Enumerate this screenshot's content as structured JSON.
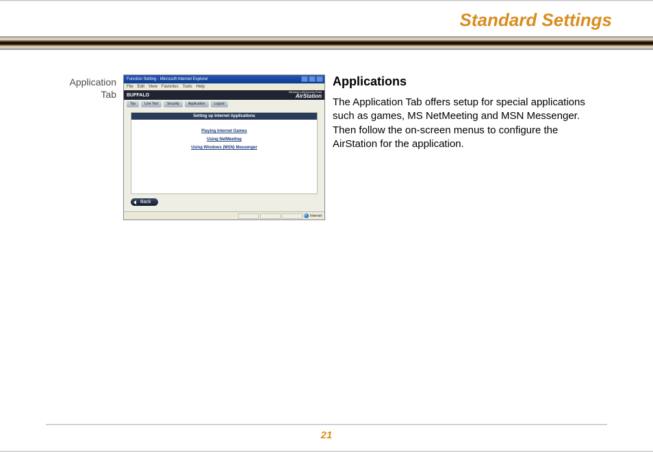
{
  "header": {
    "section_title": "Standard Settings"
  },
  "caption": {
    "line1": "Application",
    "line2": "Tab"
  },
  "screenshot": {
    "window_title": "Function Setting - Microsoft Internet Explorer",
    "menu": {
      "file": "File",
      "edit": "Edit",
      "view": "View",
      "favorites": "Favorites",
      "tools": "Tools",
      "help": "Help"
    },
    "brand": {
      "name": "BUFFALO",
      "subtitle": "Wireless LAN Access Point",
      "product": "AirStation"
    },
    "tabs": {
      "top": "Top",
      "line_test": "Line Test",
      "security": "Security",
      "application": "Application",
      "logout": "Logout"
    },
    "panel": {
      "title": "Setting up Internet Applications",
      "link_games": "Playing Internet Games",
      "link_netmeeting": "Using NetMeeting",
      "link_msn": "Using Windows (MSN) Messenger"
    },
    "back_label": "Back",
    "status_text": "Internet"
  },
  "content": {
    "heading": "Applications",
    "paragraph": "The Application Tab offers setup for special applications such as games, MS NetMeeting and MSN Messenger.  Then follow the on-screen menus to configure the AirStation for the application."
  },
  "footer": {
    "page_number": "21"
  }
}
